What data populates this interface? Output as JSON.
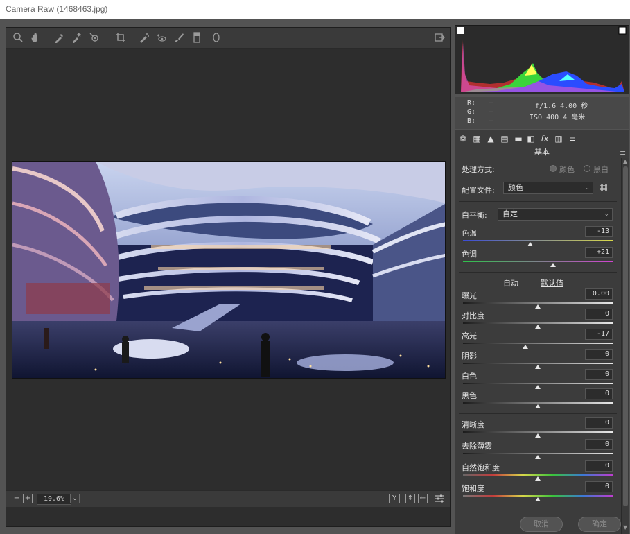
{
  "window": {
    "title": "Camera Raw (1468463.jpg)"
  },
  "status": {
    "zoom": "19.6%"
  },
  "histogram": {
    "exif_left": [
      {
        "k": "R:",
        "v": "—"
      },
      {
        "k": "G:",
        "v": "—"
      },
      {
        "k": "B:",
        "v": "—"
      }
    ],
    "exif_line1": "f/1.6  4.00 秒",
    "exif_line2": "ISO 400  4 毫米"
  },
  "panel": {
    "section_title": "基本",
    "treatment_label": "处理方式:",
    "treatment_color": "颜色",
    "treatment_bw": "黑白",
    "profile_label": "配置文件:",
    "profile_value": "颜色",
    "wb_label": "白平衡:",
    "wb_value": "自定",
    "auto_label": "自动",
    "default_label": "默认值",
    "sliders": [
      {
        "label": "色温",
        "value": "-13",
        "pos": 0.45
      },
      {
        "label": "色调",
        "value": "+21",
        "pos": 0.6
      },
      {
        "label": "曝光",
        "value": "0.00",
        "pos": 0.5
      },
      {
        "label": "对比度",
        "value": "0",
        "pos": 0.5
      },
      {
        "label": "高光",
        "value": "-17",
        "pos": 0.415
      },
      {
        "label": "阴影",
        "value": "0",
        "pos": 0.5
      },
      {
        "label": "白色",
        "value": "0",
        "pos": 0.5
      },
      {
        "label": "黑色",
        "value": "0",
        "pos": 0.5
      },
      {
        "label": "清晰度",
        "value": "0",
        "pos": 0.5
      },
      {
        "label": "去除薄雾",
        "value": "0",
        "pos": 0.5
      },
      {
        "label": "自然饱和度",
        "value": "0",
        "pos": 0.5
      },
      {
        "label": "饱和度",
        "value": "0",
        "pos": 0.5
      }
    ]
  },
  "footer": {
    "cancel": "取消",
    "ok": "确定"
  },
  "colors": {
    "accent_green": "#3ad43a",
    "accent_blue": "#2a4cff"
  }
}
